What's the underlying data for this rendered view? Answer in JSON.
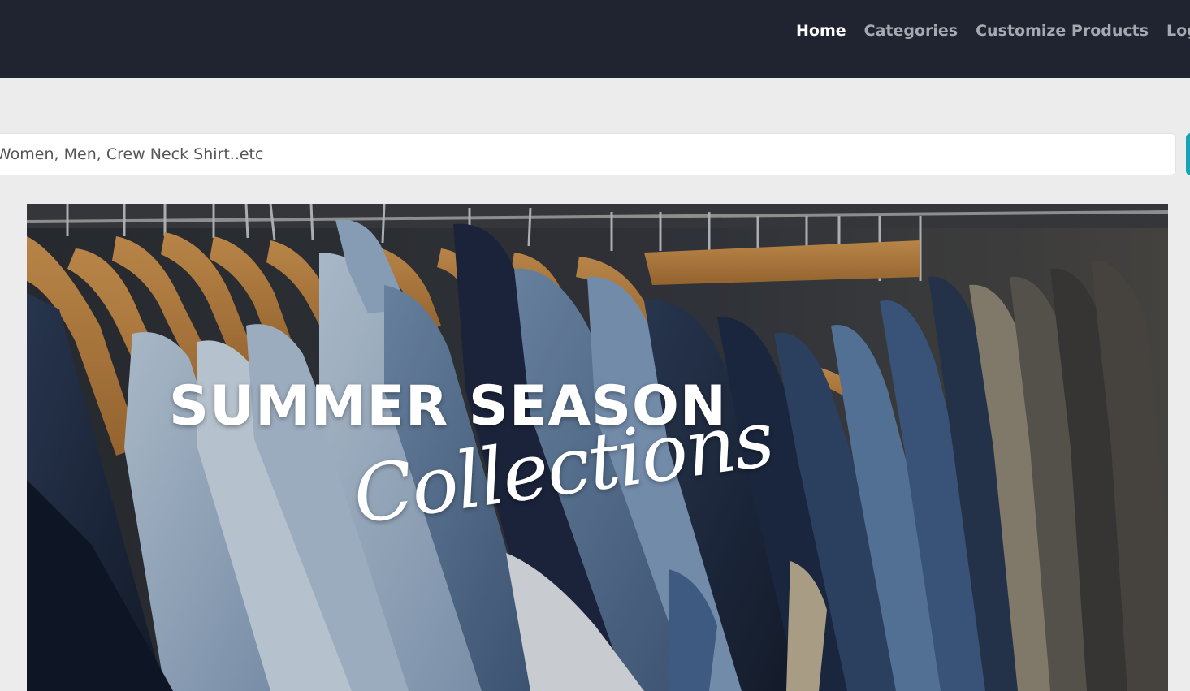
{
  "nav": {
    "links": [
      {
        "label": "Home",
        "active": true
      },
      {
        "label": "Categories",
        "active": false
      },
      {
        "label": "Customize Products",
        "active": false
      },
      {
        "label": "Log",
        "active": false
      }
    ]
  },
  "search": {
    "placeholder": "Women, Men, Crew Neck Shirt..etc"
  },
  "banner": {
    "title": "SUMMER SEASON",
    "subtitle": "Collections",
    "image": "clothing-rack-denim-jackets"
  },
  "colors": {
    "navbar_bg": "#1f2430",
    "page_bg": "#ececec",
    "nav_active": "#ffffff",
    "nav_inactive": "#a6a9b0",
    "accent": "#17a2b8"
  }
}
